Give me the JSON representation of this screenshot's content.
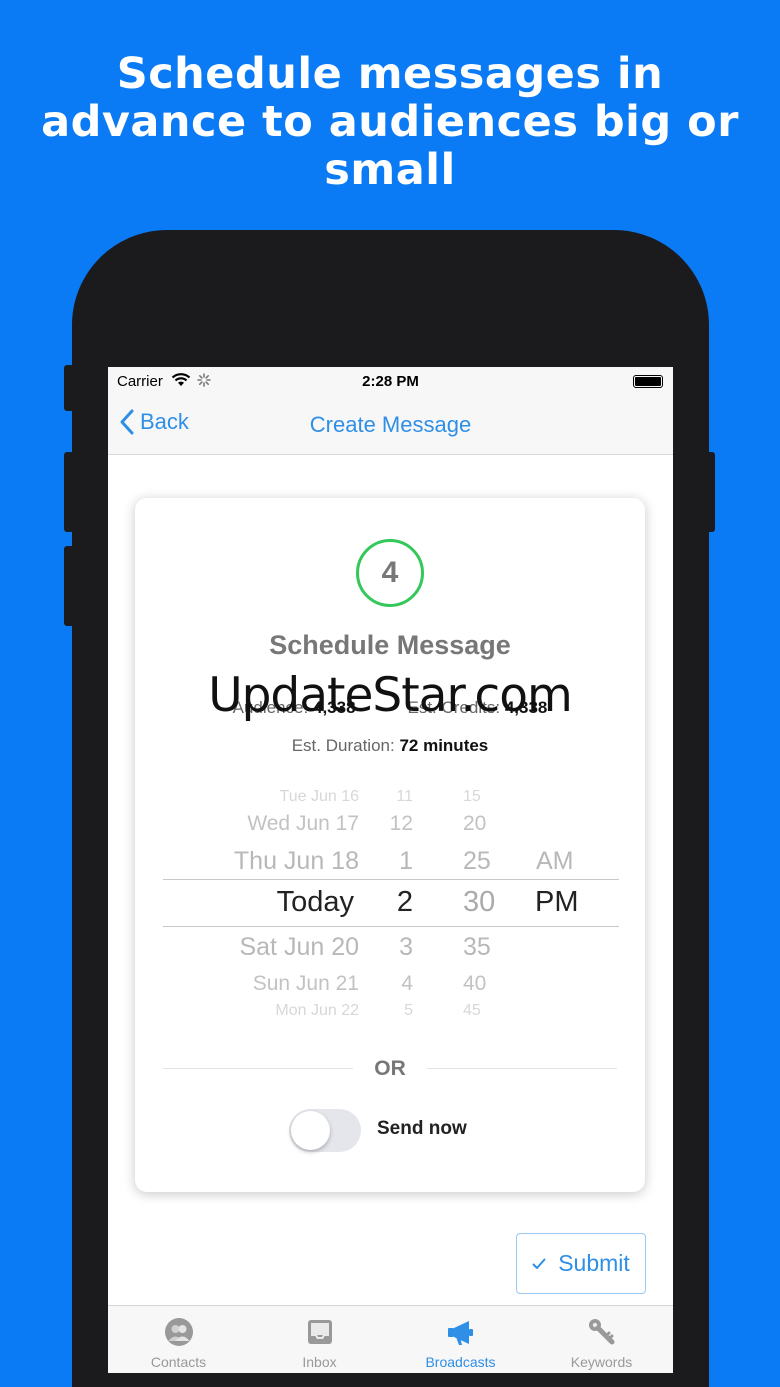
{
  "headline": {
    "line1": "Schedule messages in",
    "line2": "advance to audiences big or",
    "line3": "small"
  },
  "status_bar": {
    "carrier": "Carrier",
    "time": "2:28 PM"
  },
  "nav": {
    "back_label": "Back",
    "title": "Create Message"
  },
  "card": {
    "step": "4",
    "title": "Schedule Message",
    "audience_label": "Audience:",
    "audience_value": "4,338",
    "credits_label": "Est. Credits:",
    "credits_value": "4,338",
    "duration_label": "Est. Duration:",
    "duration_value": "72 minutes"
  },
  "watermark": "UpdateStar.com",
  "picker": {
    "dates": [
      "Tue Jun 16",
      "Wed Jun 17",
      "Thu Jun 18",
      "Today",
      "Sat Jun 20",
      "Sun Jun 21",
      "Mon Jun 22"
    ],
    "hours": [
      "11",
      "12",
      "1",
      "2",
      "3",
      "4",
      "5"
    ],
    "minutes": [
      "15",
      "20",
      "25",
      "30",
      "35",
      "40",
      "45"
    ],
    "periods": [
      "AM",
      "PM"
    ],
    "selected": {
      "date": "Today",
      "hour": "2",
      "minute": "30",
      "period": "PM"
    }
  },
  "or_label": "OR",
  "send_now": {
    "label": "Send now",
    "on": false
  },
  "submit_label": "Submit",
  "tabs": [
    {
      "label": "Contacts",
      "icon": "contacts-icon",
      "active": false
    },
    {
      "label": "Inbox",
      "icon": "inbox-icon",
      "active": false
    },
    {
      "label": "Broadcasts",
      "icon": "megaphone-icon",
      "active": true
    },
    {
      "label": "Keywords",
      "icon": "key-icon",
      "active": false
    }
  ],
  "colors": {
    "background": "#0A7BF5",
    "accent": "#2F8FE6",
    "step_ring": "#34C759"
  }
}
